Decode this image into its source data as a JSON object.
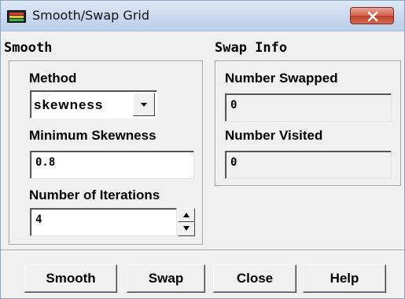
{
  "window": {
    "title": "Smooth/Swap Grid"
  },
  "smooth": {
    "section_label": "Smooth",
    "method_label": "Method",
    "method_value": "skewness",
    "min_skewness_label": "Minimum Skewness",
    "min_skewness_value": "0.8",
    "iterations_label": "Number of Iterations",
    "iterations_value": "4"
  },
  "swap_info": {
    "section_label": "Swap Info",
    "number_swapped_label": "Number Swapped",
    "number_swapped_value": "0",
    "number_visited_label": "Number Visited",
    "number_visited_value": "0"
  },
  "buttons": {
    "smooth": "Smooth",
    "swap": "Swap",
    "close": "Close",
    "help": "Help"
  },
  "icons": {
    "app": "fluent-app-icon",
    "close": "close-icon",
    "dropdown": "chevron-down-icon",
    "spin_up": "spin-up-icon",
    "spin_down": "spin-down-icon"
  },
  "colors": {
    "close_button": "#c9452f",
    "dialog_bg": "#f0f0f0",
    "titlebar": "#c7d7ee"
  }
}
